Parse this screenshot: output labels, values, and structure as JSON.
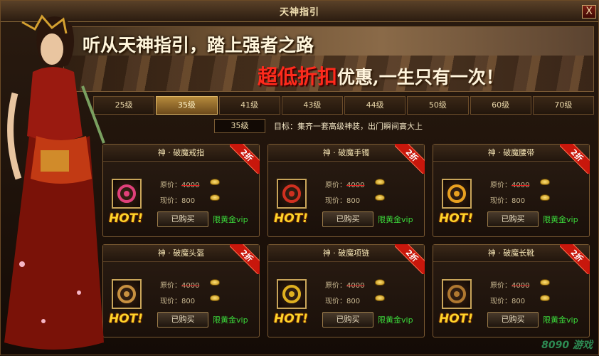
{
  "window": {
    "title": "天神指引",
    "close_label": "X"
  },
  "banner": {
    "line1": "听从天神指引，踏上强者之路",
    "line2_red": "超低折扣",
    "line2_rest": "优惠,一生只有一次！"
  },
  "tabs": [
    {
      "label": "25级",
      "active": false
    },
    {
      "label": "35级",
      "active": true
    },
    {
      "label": "41级",
      "active": false
    },
    {
      "label": "43级",
      "active": false
    },
    {
      "label": "44级",
      "active": false
    },
    {
      "label": "50级",
      "active": false
    },
    {
      "label": "60级",
      "active": false
    },
    {
      "label": "70级",
      "active": false
    }
  ],
  "target": {
    "level": "35级",
    "goal": "目标：集齐一套高级神装，出门瞬间高大上"
  },
  "cards": [
    {
      "name": "神 · 破魔戒指",
      "discount": "2折",
      "orig_label": "原价：",
      "orig_price": "4000",
      "now_label": "现价：",
      "now_price": "800",
      "buy": "已购买",
      "vip": "限黄金vip",
      "hot": "HOT!",
      "color": "#e0407a"
    },
    {
      "name": "神 · 破魔手镯",
      "discount": "2折",
      "orig_label": "原价：",
      "orig_price": "4000",
      "now_label": "现价：",
      "now_price": "800",
      "buy": "已购买",
      "vip": "限黄金vip",
      "hot": "HOT!",
      "color": "#d03020"
    },
    {
      "name": "神 · 破魔腰带",
      "discount": "2折",
      "orig_label": "原价：",
      "orig_price": "4000",
      "now_label": "现价：",
      "now_price": "800",
      "buy": "已购买",
      "vip": "限黄金vip",
      "hot": "HOT!",
      "color": "#e8a020"
    },
    {
      "name": "神 · 破魔头盔",
      "discount": "2折",
      "orig_label": "原价：",
      "orig_price": "4000",
      "now_label": "现价：",
      "now_price": "800",
      "buy": "已购买",
      "vip": "限黄金vip",
      "hot": "HOT!",
      "color": "#c89040"
    },
    {
      "name": "神 · 破魔项链",
      "discount": "2折",
      "orig_label": "原价：",
      "orig_price": "4000",
      "now_label": "现价：",
      "now_price": "800",
      "buy": "已购买",
      "vip": "限黄金vip",
      "hot": "HOT!",
      "color": "#e0b020"
    },
    {
      "name": "神 · 破魔长靴",
      "discount": "2折",
      "orig_label": "原价：",
      "orig_price": "4000",
      "now_label": "现价：",
      "now_price": "800",
      "buy": "已购买",
      "vip": "限黄金vip",
      "hot": "HOT!",
      "color": "#b07830"
    }
  ],
  "watermark": "8090 游戏"
}
